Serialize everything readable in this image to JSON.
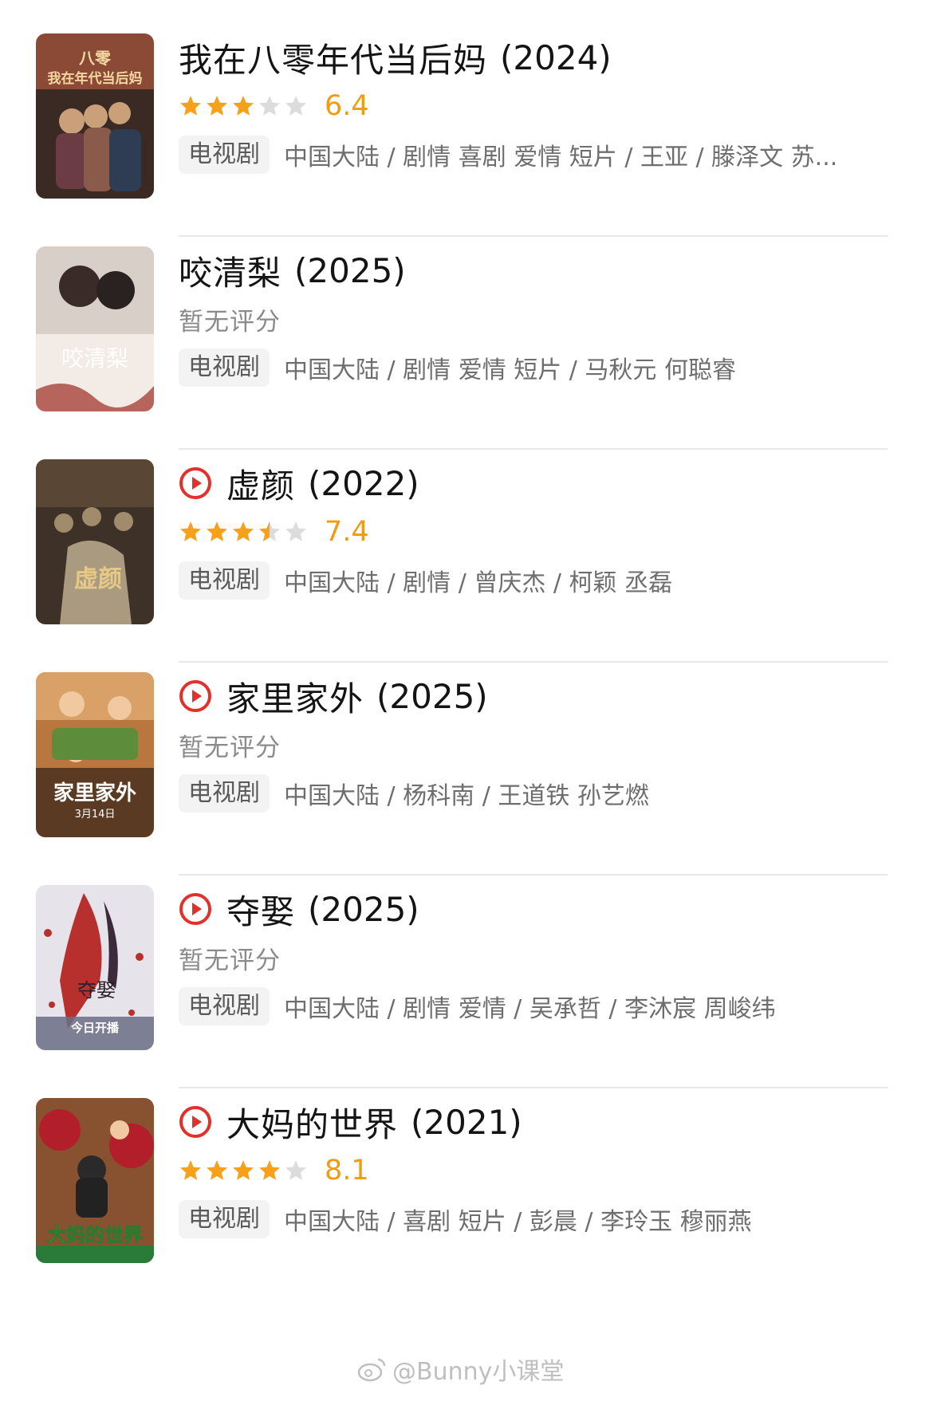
{
  "items": [
    {
      "title": "我在八零年代当后妈",
      "year": "(2024)",
      "has_play_icon": false,
      "rating": 6.4,
      "score_text": "6.4",
      "stars": [
        1,
        1,
        1,
        0,
        0
      ],
      "no_score_text": "",
      "type_tag": "电视剧",
      "meta": "中国大陆 / 剧情 喜剧 爱情 短片 / 王亚 / 滕泽文 苏...",
      "poster_colors": [
        "#8a4a36",
        "#c9a07a",
        "#3b2a24"
      ]
    },
    {
      "title": "咬清梨",
      "year": "(2025)",
      "has_play_icon": false,
      "rating": null,
      "score_text": "",
      "stars": [],
      "no_score_text": "暂无评分",
      "type_tag": "电视剧",
      "meta": "中国大陆 / 剧情 爱情 短片 / 马秋元 何聪睿",
      "poster_colors": [
        "#d8cfc8",
        "#f2ebe6",
        "#a8443a"
      ]
    },
    {
      "title": "虚颜",
      "year": "(2022)",
      "has_play_icon": true,
      "rating": 7.4,
      "score_text": "7.4",
      "stars": [
        1,
        1,
        1,
        0.5,
        0
      ],
      "no_score_text": "",
      "type_tag": "电视剧",
      "meta": "中国大陆 / 剧情 / 曾庆杰 / 柯颖 丞磊",
      "poster_colors": [
        "#3d3128",
        "#a08c6c",
        "#d9c8a4"
      ]
    },
    {
      "title": "家里家外",
      "year": "(2025)",
      "has_play_icon": true,
      "rating": null,
      "score_text": "",
      "stars": [],
      "no_score_text": "暂无评分",
      "type_tag": "电视剧",
      "meta": "中国大陆 / 杨科南 / 王道铁 孙艺燃",
      "poster_colors": [
        "#b9763e",
        "#e6b383",
        "#5a3a22"
      ]
    },
    {
      "title": "夺娶",
      "year": "(2025)",
      "has_play_icon": true,
      "rating": null,
      "score_text": "",
      "stars": [],
      "no_score_text": "暂无评分",
      "type_tag": "电视剧",
      "meta": "中国大陆 / 剧情 爱情 / 吴承哲 / 李沐宸 周峻纬",
      "poster_colors": [
        "#e7e3ea",
        "#b8302e",
        "#3a2a3a"
      ]
    },
    {
      "title": "大妈的世界",
      "year": "(2021)",
      "has_play_icon": true,
      "rating": 8.1,
      "score_text": "8.1",
      "stars": [
        1,
        1,
        1,
        1,
        0
      ],
      "no_score_text": "",
      "type_tag": "电视剧",
      "meta": "中国大陆 / 喜剧 短片 / 彭晨 / 李玲玉 穆丽燕",
      "poster_colors": [
        "#c42d2a",
        "#2f8a3e",
        "#f2d13b"
      ]
    }
  ],
  "poster_texts": [
    {
      "lines": [
        "八零",
        "我在年代当后妈"
      ],
      "color": "#f4d7a0"
    },
    {
      "lines": [
        "咬清梨"
      ],
      "color": "#ffffff"
    },
    {
      "lines": [
        "虚颜"
      ],
      "color": "#e7c987"
    },
    {
      "lines": [
        "家里家外",
        "3月14日"
      ],
      "color": "#ffffff"
    },
    {
      "lines": [
        "夺娶",
        "今日开播"
      ],
      "color": "#ffffff"
    },
    {
      "lines": [
        "大妈的世界"
      ],
      "color": "#ffe23a"
    }
  ],
  "watermark": {
    "text": "@Bunny小课堂",
    "icon": "weibo-icon"
  },
  "colors": {
    "accent_star": "#f7a11b",
    "empty_star": "#dcdcdc",
    "score": "#f29a12",
    "play_icon": "#e4302b"
  }
}
